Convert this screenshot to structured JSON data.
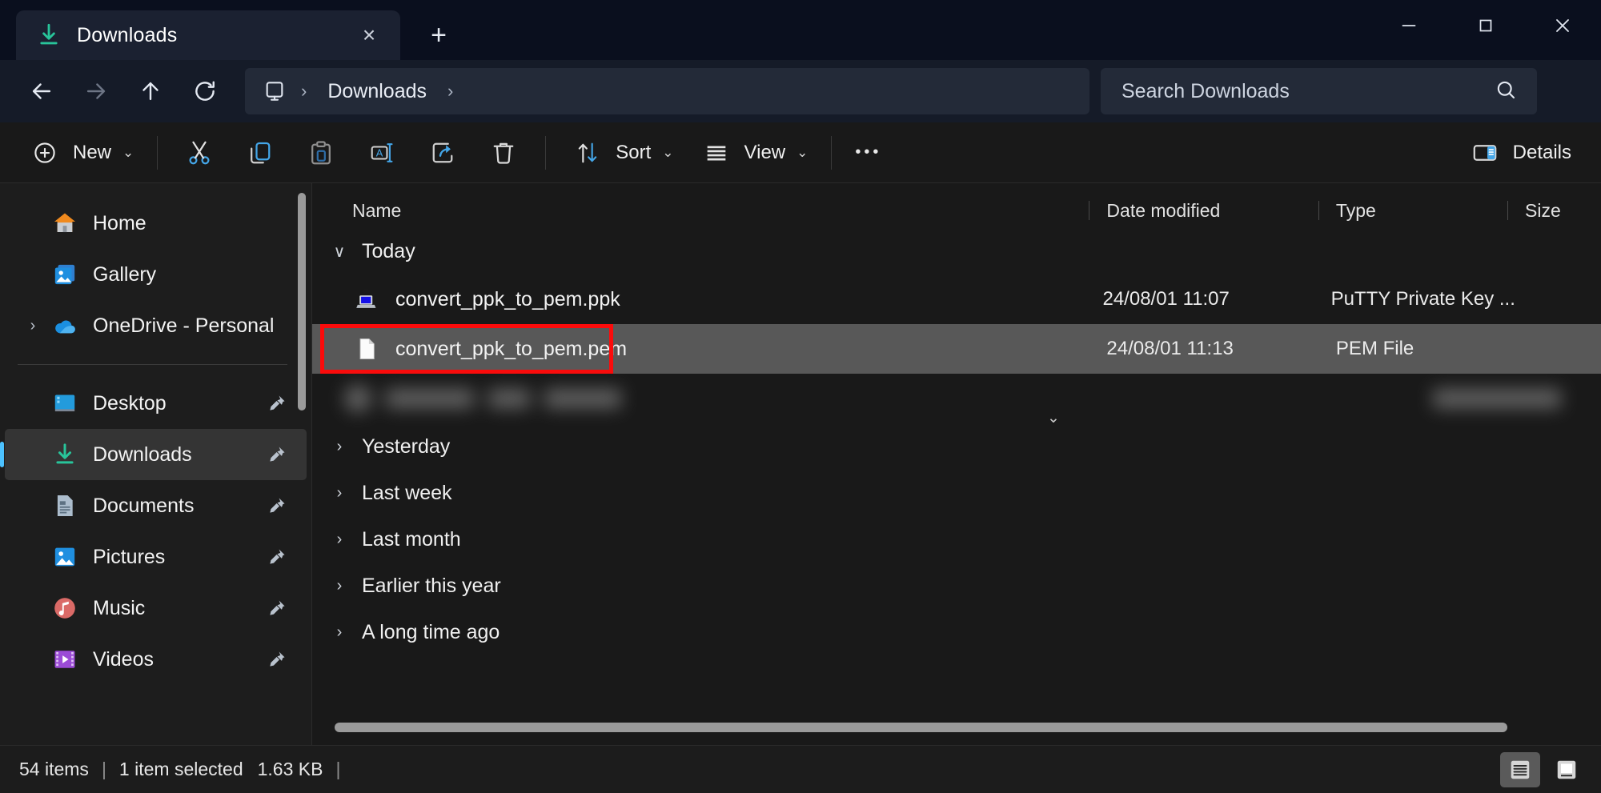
{
  "window": {
    "tab": {
      "title": "Downloads",
      "icon": "downloads-arrow-icon",
      "close_label": "×"
    },
    "new_tab_label": "+",
    "controls": {
      "minimize": "minimize-icon",
      "maximize": "maximize-icon",
      "close": "close-icon"
    }
  },
  "address": {
    "back": "back-arrow-icon",
    "forward": "forward-arrow-icon",
    "up": "up-arrow-icon",
    "refresh": "refresh-icon",
    "breadcrumb_root_icon": "this-pc-icon",
    "breadcrumb": [
      "Downloads"
    ],
    "chevron": "›"
  },
  "search": {
    "placeholder": "Search Downloads",
    "value": "",
    "icon": "search-icon"
  },
  "toolbar": {
    "new_label": "New",
    "cut_label": "Cut",
    "copy_label": "Copy",
    "paste_label": "Paste",
    "rename_label": "Rename",
    "share_label": "Share",
    "delete_label": "Delete",
    "sort_label": "Sort",
    "view_label": "View",
    "more_label": "•••",
    "details_label": "Details",
    "caret": "⌄"
  },
  "sidebar": {
    "items": [
      {
        "label": "Home",
        "icon": "home-icon",
        "pinned": false,
        "expandable": false,
        "selected": false
      },
      {
        "label": "Gallery",
        "icon": "gallery-icon",
        "pinned": false,
        "expandable": false,
        "selected": false
      },
      {
        "label": "OneDrive - Personal",
        "icon": "onedrive-cloud-icon",
        "pinned": false,
        "expandable": true,
        "selected": false
      }
    ],
    "quick_access": [
      {
        "label": "Desktop",
        "icon": "desktop-icon",
        "pinned": true,
        "selected": false
      },
      {
        "label": "Downloads",
        "icon": "downloads-arrow-icon",
        "pinned": true,
        "selected": true
      },
      {
        "label": "Documents",
        "icon": "documents-icon",
        "pinned": true,
        "selected": false
      },
      {
        "label": "Pictures",
        "icon": "pictures-icon",
        "pinned": true,
        "selected": false
      },
      {
        "label": "Music",
        "icon": "music-icon",
        "pinned": true,
        "selected": false
      },
      {
        "label": "Videos",
        "icon": "videos-icon",
        "pinned": true,
        "selected": false
      }
    ]
  },
  "filelist": {
    "columns": [
      "Name",
      "Date modified",
      "Type",
      "Size"
    ],
    "sort_indicator": "⌄",
    "groups": [
      {
        "label": "Today",
        "expanded": true,
        "files": [
          {
            "name": "convert_ppk_to_pem.ppk",
            "date_modified": "24/08/01 11:07",
            "type": "PuTTY Private Key ...",
            "size": "",
            "icon": "putty-key-icon",
            "selected": false,
            "highlighted": false,
            "blurred": false
          },
          {
            "name": "convert_ppk_to_pem.pem",
            "date_modified": "24/08/01 11:13",
            "type": "PEM File",
            "size": "",
            "icon": "generic-file-icon",
            "selected": true,
            "highlighted": true,
            "blurred": false
          },
          {
            "name": "",
            "date_modified": "",
            "type": "",
            "size": "",
            "icon": "generic-file-icon",
            "selected": false,
            "highlighted": false,
            "blurred": true
          }
        ]
      },
      {
        "label": "Yesterday",
        "expanded": false,
        "files": []
      },
      {
        "label": "Last week",
        "expanded": false,
        "files": []
      },
      {
        "label": "Last month",
        "expanded": false,
        "files": []
      },
      {
        "label": "Earlier this year",
        "expanded": false,
        "files": []
      },
      {
        "label": "A long time ago",
        "expanded": false,
        "files": []
      }
    ]
  },
  "statusbar": {
    "item_count": "54 items",
    "divider": "|",
    "selection": "1 item selected",
    "selection_size": "1.63 KB",
    "trailing_divider": "|",
    "view_details_icon": "details-view-icon",
    "view_large_icon": "large-icons-view-icon"
  },
  "colors": {
    "accent": "#4cc2ff",
    "highlight_box": "#fb0b0b",
    "titlebar_bg": "#0a0f1e",
    "addressbar_bg": "#151b28",
    "content_bg": "#191919",
    "sidebar_bg": "#1d1d1d",
    "row_selected_bg": "#585858",
    "downloads_green": "#28c49a"
  }
}
